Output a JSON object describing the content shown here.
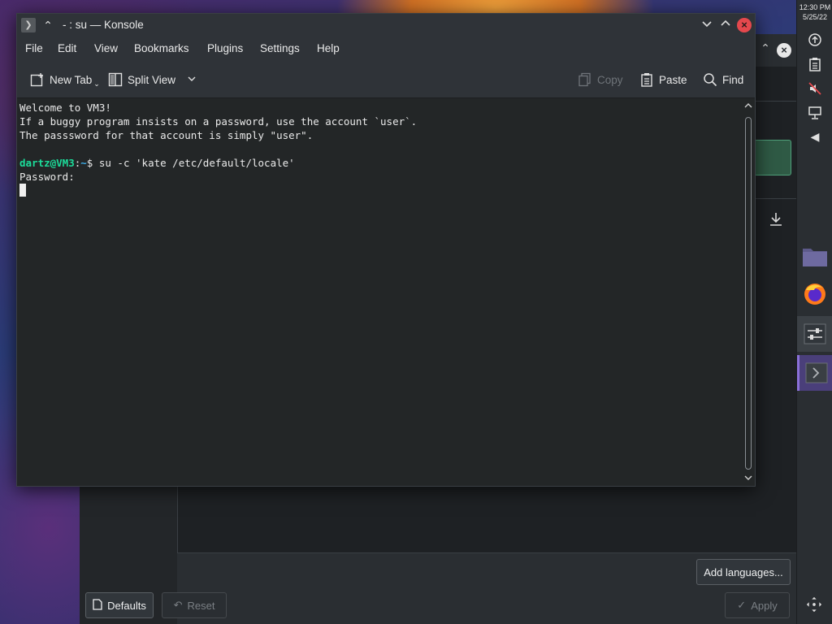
{
  "window": {
    "title": "- : su — Konsole"
  },
  "menu": [
    "File",
    "Edit",
    "View",
    "Bookmarks",
    "Plugins",
    "Settings",
    "Help"
  ],
  "toolbar": {
    "new_tab": "New Tab",
    "split_view": "Split View",
    "copy": "Copy",
    "paste": "Paste",
    "find": "Find"
  },
  "terminal": {
    "line1": "Welcome to VM3!",
    "line2": "If a buggy program insists on a password, use the account `user`.",
    "line3": "The passsword for that account is simply \"user\".",
    "prompt_user": "dartz@VM3",
    "prompt_sep": ":",
    "prompt_path": "~",
    "prompt_dollar": "$ ",
    "command": "su -c 'kate /etc/default/locale'",
    "line_password": "Password:"
  },
  "background_app": {
    "add_languages": "Add languages...",
    "defaults": "Defaults",
    "reset": "Reset",
    "apply": "Apply"
  },
  "panel": {
    "time": "12:30 PM",
    "date": "5/25/22"
  },
  "icons": {
    "app": "konsole-icon",
    "keep_above": "keep-above-icon",
    "minimize": "chevron-down-icon",
    "maximize": "chevron-up-icon",
    "close": "close-icon"
  },
  "colors": {
    "prompt_user": "#1cdc9a",
    "prompt_path": "#3daee9",
    "close_button": "#e5484d",
    "selected_task": "#4a3f7a"
  }
}
